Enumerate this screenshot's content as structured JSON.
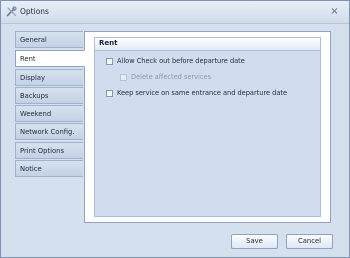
{
  "window": {
    "title": "Options",
    "close_glyph": "×"
  },
  "tabs": [
    {
      "label": "General",
      "active": false
    },
    {
      "label": "Rent",
      "active": true
    },
    {
      "label": "Display",
      "active": false
    },
    {
      "label": "Backups",
      "active": false
    },
    {
      "label": "Weekend",
      "active": false
    },
    {
      "label": "Network Config.",
      "active": false
    },
    {
      "label": "Print Options",
      "active": false
    },
    {
      "label": "Notice",
      "active": false
    }
  ],
  "panel": {
    "title": "Rent",
    "options": [
      {
        "label": "Allow Check out before departure date",
        "checked": false,
        "enabled": true
      },
      {
        "label": "Delete affected services",
        "checked": false,
        "enabled": false
      },
      {
        "label": "Keep service on same entrance and departure date",
        "checked": false,
        "enabled": true
      }
    ]
  },
  "buttons": {
    "save": "Save",
    "cancel": "Cancel"
  },
  "icons": {
    "title_icon": "tools-icon",
    "close_icon": "close-icon"
  }
}
